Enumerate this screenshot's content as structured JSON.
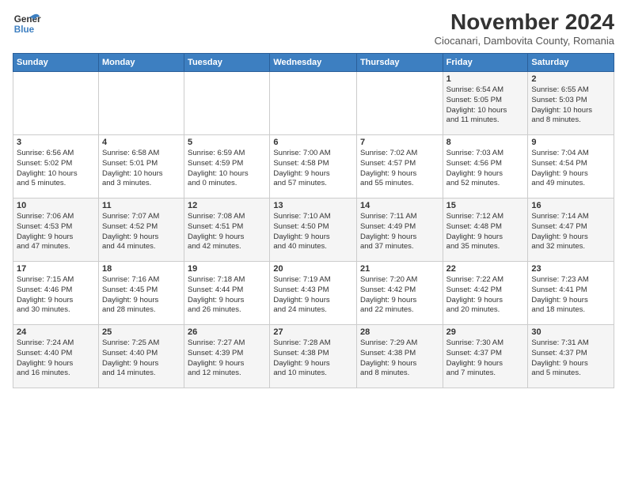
{
  "logo": {
    "line1": "General",
    "line2": "Blue"
  },
  "title": "November 2024",
  "location": "Ciocanari, Dambovita County, Romania",
  "weekdays": [
    "Sunday",
    "Monday",
    "Tuesday",
    "Wednesday",
    "Thursday",
    "Friday",
    "Saturday"
  ],
  "weeks": [
    [
      {
        "day": "",
        "info": ""
      },
      {
        "day": "",
        "info": ""
      },
      {
        "day": "",
        "info": ""
      },
      {
        "day": "",
        "info": ""
      },
      {
        "day": "",
        "info": ""
      },
      {
        "day": "1",
        "info": "Sunrise: 6:54 AM\nSunset: 5:05 PM\nDaylight: 10 hours\nand 11 minutes."
      },
      {
        "day": "2",
        "info": "Sunrise: 6:55 AM\nSunset: 5:03 PM\nDaylight: 10 hours\nand 8 minutes."
      }
    ],
    [
      {
        "day": "3",
        "info": "Sunrise: 6:56 AM\nSunset: 5:02 PM\nDaylight: 10 hours\nand 5 minutes."
      },
      {
        "day": "4",
        "info": "Sunrise: 6:58 AM\nSunset: 5:01 PM\nDaylight: 10 hours\nand 3 minutes."
      },
      {
        "day": "5",
        "info": "Sunrise: 6:59 AM\nSunset: 4:59 PM\nDaylight: 10 hours\nand 0 minutes."
      },
      {
        "day": "6",
        "info": "Sunrise: 7:00 AM\nSunset: 4:58 PM\nDaylight: 9 hours\nand 57 minutes."
      },
      {
        "day": "7",
        "info": "Sunrise: 7:02 AM\nSunset: 4:57 PM\nDaylight: 9 hours\nand 55 minutes."
      },
      {
        "day": "8",
        "info": "Sunrise: 7:03 AM\nSunset: 4:56 PM\nDaylight: 9 hours\nand 52 minutes."
      },
      {
        "day": "9",
        "info": "Sunrise: 7:04 AM\nSunset: 4:54 PM\nDaylight: 9 hours\nand 49 minutes."
      }
    ],
    [
      {
        "day": "10",
        "info": "Sunrise: 7:06 AM\nSunset: 4:53 PM\nDaylight: 9 hours\nand 47 minutes."
      },
      {
        "day": "11",
        "info": "Sunrise: 7:07 AM\nSunset: 4:52 PM\nDaylight: 9 hours\nand 44 minutes."
      },
      {
        "day": "12",
        "info": "Sunrise: 7:08 AM\nSunset: 4:51 PM\nDaylight: 9 hours\nand 42 minutes."
      },
      {
        "day": "13",
        "info": "Sunrise: 7:10 AM\nSunset: 4:50 PM\nDaylight: 9 hours\nand 40 minutes."
      },
      {
        "day": "14",
        "info": "Sunrise: 7:11 AM\nSunset: 4:49 PM\nDaylight: 9 hours\nand 37 minutes."
      },
      {
        "day": "15",
        "info": "Sunrise: 7:12 AM\nSunset: 4:48 PM\nDaylight: 9 hours\nand 35 minutes."
      },
      {
        "day": "16",
        "info": "Sunrise: 7:14 AM\nSunset: 4:47 PM\nDaylight: 9 hours\nand 32 minutes."
      }
    ],
    [
      {
        "day": "17",
        "info": "Sunrise: 7:15 AM\nSunset: 4:46 PM\nDaylight: 9 hours\nand 30 minutes."
      },
      {
        "day": "18",
        "info": "Sunrise: 7:16 AM\nSunset: 4:45 PM\nDaylight: 9 hours\nand 28 minutes."
      },
      {
        "day": "19",
        "info": "Sunrise: 7:18 AM\nSunset: 4:44 PM\nDaylight: 9 hours\nand 26 minutes."
      },
      {
        "day": "20",
        "info": "Sunrise: 7:19 AM\nSunset: 4:43 PM\nDaylight: 9 hours\nand 24 minutes."
      },
      {
        "day": "21",
        "info": "Sunrise: 7:20 AM\nSunset: 4:42 PM\nDaylight: 9 hours\nand 22 minutes."
      },
      {
        "day": "22",
        "info": "Sunrise: 7:22 AM\nSunset: 4:42 PM\nDaylight: 9 hours\nand 20 minutes."
      },
      {
        "day": "23",
        "info": "Sunrise: 7:23 AM\nSunset: 4:41 PM\nDaylight: 9 hours\nand 18 minutes."
      }
    ],
    [
      {
        "day": "24",
        "info": "Sunrise: 7:24 AM\nSunset: 4:40 PM\nDaylight: 9 hours\nand 16 minutes."
      },
      {
        "day": "25",
        "info": "Sunrise: 7:25 AM\nSunset: 4:40 PM\nDaylight: 9 hours\nand 14 minutes."
      },
      {
        "day": "26",
        "info": "Sunrise: 7:27 AM\nSunset: 4:39 PM\nDaylight: 9 hours\nand 12 minutes."
      },
      {
        "day": "27",
        "info": "Sunrise: 7:28 AM\nSunset: 4:38 PM\nDaylight: 9 hours\nand 10 minutes."
      },
      {
        "day": "28",
        "info": "Sunrise: 7:29 AM\nSunset: 4:38 PM\nDaylight: 9 hours\nand 8 minutes."
      },
      {
        "day": "29",
        "info": "Sunrise: 7:30 AM\nSunset: 4:37 PM\nDaylight: 9 hours\nand 7 minutes."
      },
      {
        "day": "30",
        "info": "Sunrise: 7:31 AM\nSunset: 4:37 PM\nDaylight: 9 hours\nand 5 minutes."
      }
    ]
  ]
}
